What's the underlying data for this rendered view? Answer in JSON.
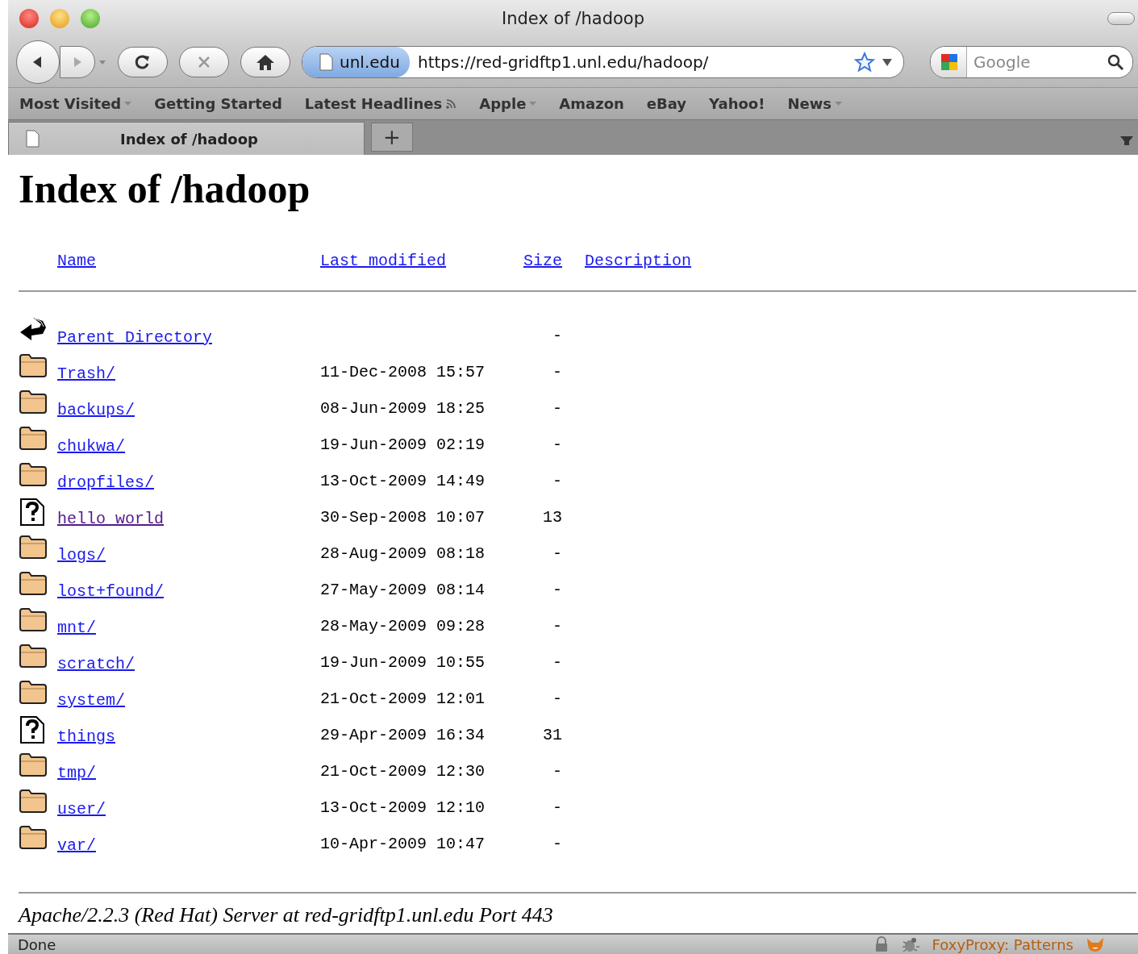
{
  "window": {
    "title": "Index of /hadoop"
  },
  "toolbar": {
    "site_badge": "unl.edu",
    "url": "https://red-gridftp1.unl.edu/hadoop/",
    "search_placeholder": "Google"
  },
  "bookmarks": [
    {
      "label": "Most Visited",
      "menu": true,
      "feed": false
    },
    {
      "label": "Getting Started",
      "menu": false,
      "feed": false
    },
    {
      "label": "Latest Headlines",
      "menu": false,
      "feed": true
    },
    {
      "label": "Apple",
      "menu": true,
      "feed": false
    },
    {
      "label": "Amazon",
      "menu": false,
      "feed": false
    },
    {
      "label": "eBay",
      "menu": false,
      "feed": false
    },
    {
      "label": "Yahoo!",
      "menu": false,
      "feed": false
    },
    {
      "label": "News",
      "menu": true,
      "feed": false
    }
  ],
  "tabs": [
    {
      "label": "Index of /hadoop",
      "selected": true
    }
  ],
  "new_tab_button": "+",
  "page": {
    "heading": "Index of /hadoop",
    "columns": [
      "Name",
      "Last modified",
      "Size",
      "Description"
    ],
    "rows": [
      {
        "kind": "parent",
        "name": "Parent Directory",
        "modified": "",
        "size": "-",
        "visited": false
      },
      {
        "kind": "folder",
        "name": "Trash/",
        "modified": "11-Dec-2008 15:57",
        "size": "-",
        "visited": false
      },
      {
        "kind": "folder",
        "name": "backups/",
        "modified": "08-Jun-2009 18:25",
        "size": "-",
        "visited": false
      },
      {
        "kind": "folder",
        "name": "chukwa/",
        "modified": "19-Jun-2009 02:19",
        "size": "-",
        "visited": false
      },
      {
        "kind": "folder",
        "name": "dropfiles/",
        "modified": "13-Oct-2009 14:49",
        "size": "-",
        "visited": false
      },
      {
        "kind": "file",
        "name": "hello world",
        "modified": "30-Sep-2008 10:07",
        "size": "13",
        "visited": true
      },
      {
        "kind": "folder",
        "name": "logs/",
        "modified": "28-Aug-2009 08:18",
        "size": "-",
        "visited": false
      },
      {
        "kind": "folder",
        "name": "lost+found/",
        "modified": "27-May-2009 08:14",
        "size": "-",
        "visited": false
      },
      {
        "kind": "folder",
        "name": "mnt/",
        "modified": "28-May-2009 09:28",
        "size": "-",
        "visited": false
      },
      {
        "kind": "folder",
        "name": "scratch/",
        "modified": "19-Jun-2009 10:55",
        "size": "-",
        "visited": false
      },
      {
        "kind": "folder",
        "name": "system/",
        "modified": "21-Oct-2009 12:01",
        "size": "-",
        "visited": false
      },
      {
        "kind": "file",
        "name": "things",
        "modified": "29-Apr-2009 16:34",
        "size": "31",
        "visited": false
      },
      {
        "kind": "folder",
        "name": "tmp/",
        "modified": "21-Oct-2009 12:30",
        "size": "-",
        "visited": false
      },
      {
        "kind": "folder",
        "name": "user/",
        "modified": "13-Oct-2009 12:10",
        "size": "-",
        "visited": false
      },
      {
        "kind": "folder",
        "name": "var/",
        "modified": "10-Apr-2009 10:47",
        "size": "-",
        "visited": false
      }
    ],
    "footer": "Apache/2.2.3 (Red Hat) Server at red-gridftp1.unl.edu Port 443"
  },
  "status_bar": {
    "text": "Done",
    "proxy": "FoxyProxy: Patterns"
  }
}
